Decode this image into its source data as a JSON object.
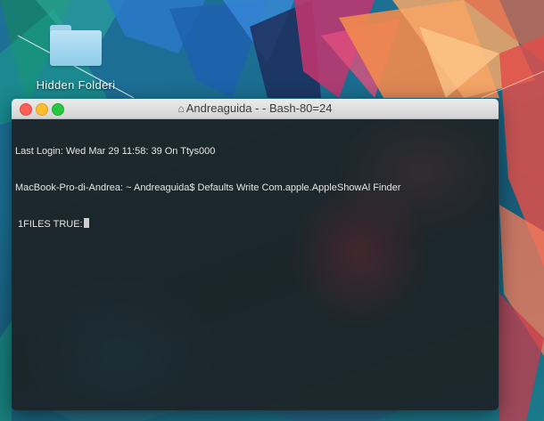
{
  "desktop": {
    "folder_label": "Hidden Folderi",
    "colors": {
      "wallpaper_base": "#1a6d8f",
      "folder": "#9fd3ec"
    }
  },
  "terminal": {
    "title": "Andreaguida - - Bash-80=24",
    "title_icon": "home-icon",
    "lines": [
      "Last Login: Wed Mar 29 11:58: 39 On Ttys000",
      "MacBook-Pro-di-Andrea: ~ Andreaguida$ Defaults Write Com.apple.AppleShowAl Finder",
      " 1FILES TRUE:"
    ],
    "colors": {
      "background": "#1c2226",
      "text": "#e6e6e6",
      "close": "#fc5f57",
      "minimize": "#fdbc2e",
      "zoom": "#28c840"
    }
  }
}
